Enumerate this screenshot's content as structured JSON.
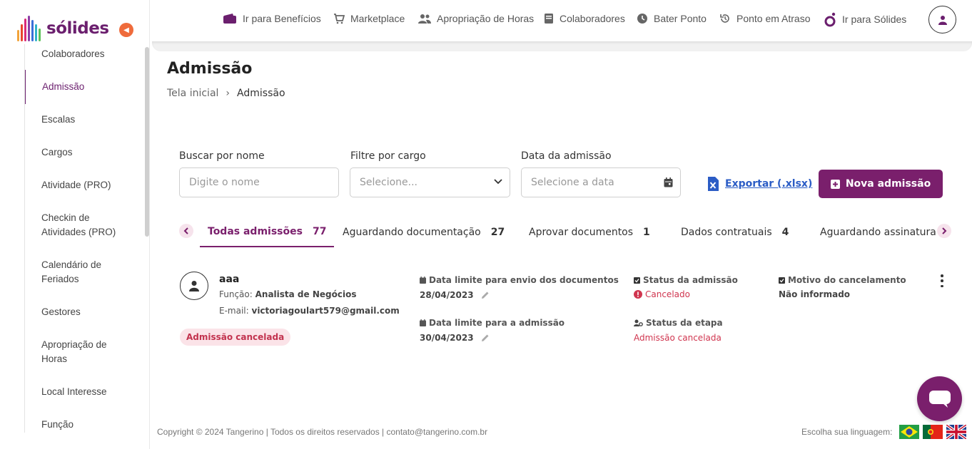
{
  "brand": {
    "name": "sólides",
    "accent": "#7a1f6c",
    "orange": "#ef6b3b"
  },
  "sidebar": {
    "items": [
      {
        "label": "Colaboradores",
        "active": false
      },
      {
        "label": "Admissão",
        "active": true
      },
      {
        "label": "Escalas",
        "active": false
      },
      {
        "label": "Cargos",
        "active": false
      },
      {
        "label": "Atividade (PRO)",
        "active": false
      },
      {
        "label": "Checkin de Atividades (PRO)",
        "active": false
      },
      {
        "label": "Calendário de Feriados",
        "active": false
      },
      {
        "label": "Gestores",
        "active": false
      },
      {
        "label": "Apropriação de Horas",
        "active": false
      },
      {
        "label": "Local Interesse",
        "active": false
      },
      {
        "label": "Função",
        "active": false
      }
    ]
  },
  "topbar": {
    "links": [
      {
        "label": "Ir para Benefícios",
        "icon": "wallet-icon"
      },
      {
        "label": "Marketplace",
        "icon": "cart-icon"
      },
      {
        "label": "Apropriação de Horas",
        "icon": "users-icon"
      },
      {
        "label": "Colaboradores",
        "icon": "book-icon"
      },
      {
        "label": "Bater Ponto",
        "icon": "clock-icon"
      },
      {
        "label": "Ponto em Atraso",
        "icon": "history-icon"
      },
      {
        "label": "Ir para Sólides",
        "icon": "solides-logo-icon"
      }
    ]
  },
  "page": {
    "title": "Admissão",
    "breadcrumb": {
      "home": "Tela inicial",
      "separator": "›",
      "current": "Admissão"
    }
  },
  "filters": {
    "name": {
      "label": "Buscar por nome",
      "placeholder": "Digite o nome"
    },
    "role": {
      "label": "Filtre por cargo",
      "placeholder": "Selecione..."
    },
    "date": {
      "label": "Data da admissão",
      "placeholder": "Selecione a data"
    }
  },
  "actions": {
    "export": "Exportar (.xlsx)",
    "new": "Nova admissão"
  },
  "tabs": [
    {
      "label": "Todas admissões",
      "count": "77",
      "active": true
    },
    {
      "label": "Aguardando documentação",
      "count": "27",
      "active": false
    },
    {
      "label": "Aprovar documentos",
      "count": "1",
      "active": false
    },
    {
      "label": "Dados contratuais",
      "count": "4",
      "active": false
    },
    {
      "label": "Aguardando assinatura",
      "count": "",
      "active": false
    }
  ],
  "admission": {
    "name": "aaa",
    "role_label": "Função:",
    "role": "Analista de Negócios",
    "email_label": "E-mail:",
    "email": "victoriagoulart579@gmail.com",
    "badge": "Admissão cancelada",
    "docs_deadline_label": "Data limite para envio dos documentos",
    "docs_deadline": "28/04/2023",
    "admission_deadline_label": "Data limite para a admissão",
    "admission_deadline": "30/04/2023",
    "status_label": "Status da admissão",
    "status": "Cancelado",
    "step_label": "Status da etapa",
    "step": "Admissão cancelada",
    "cancel_reason_label": "Motivo do cancelamento",
    "cancel_reason": "Não informado"
  },
  "footer": {
    "copyright": "Copyright © 2024 Tangerino | Todos os direitos reservados | contato@tangerino.com.br",
    "language_label": "Escolha sua linguagem:"
  }
}
